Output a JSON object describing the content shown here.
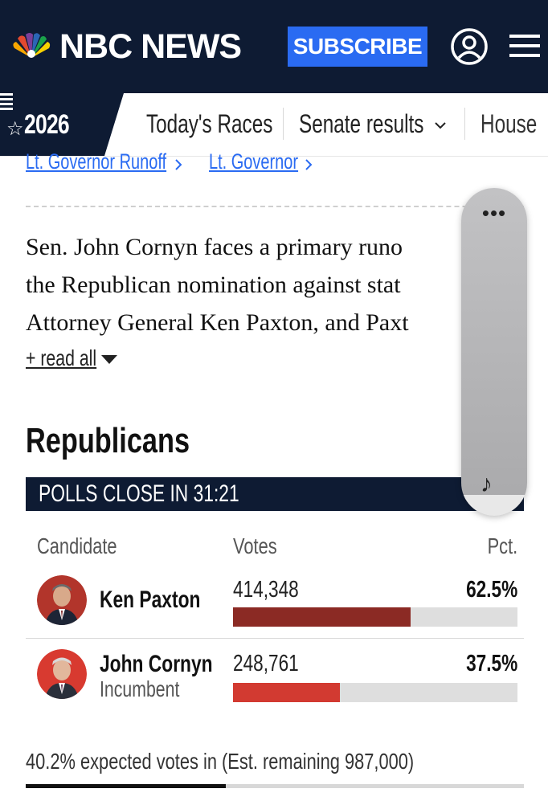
{
  "header": {
    "brand": "NBC NEWS",
    "subscribe_label": "SUBSCRIBE",
    "account_icon": "account-circle-icon",
    "menu_icon": "hamburger-menu-icon",
    "colors": {
      "bg": "#0e1b33",
      "subscribe": "#2a6bf2"
    }
  },
  "subnav": {
    "badge": "2026",
    "items": [
      {
        "label": "Today's Races"
      },
      {
        "label": "Senate results"
      },
      {
        "label": "House"
      }
    ]
  },
  "sublinks": [
    {
      "label": "Lt. Governor Runoff"
    },
    {
      "label": "Lt. Governor"
    }
  ],
  "intro": {
    "lines": [
      "Sen. John Cornyn faces a primary runo",
      "the Republican nomination against stat",
      "Attorney General Ken Paxton, and Paxt"
    ],
    "read_all": "+ read all"
  },
  "race": {
    "party": "Republicans",
    "polls_close": "POLLS CLOSE IN 31:21",
    "columns": {
      "candidate": "Candidate",
      "votes": "Votes",
      "pct": "Pct."
    },
    "candidates": [
      {
        "name": "Ken Paxton",
        "status": "",
        "votes": "414,348",
        "pct": "62.5%",
        "share": 0.625,
        "color": "#8b2a24"
      },
      {
        "name": "John Cornyn",
        "status": "Incumbent",
        "votes": "248,761",
        "pct": "37.5%",
        "share": 0.375,
        "color": "#d23a31"
      }
    ],
    "expected": "40.2% expected votes in (Est. remaining 987,000)",
    "expected_share": 0.402
  },
  "floating_player": {
    "menu_icon": "more-dots-icon",
    "note_icon": "music-note-icon"
  }
}
